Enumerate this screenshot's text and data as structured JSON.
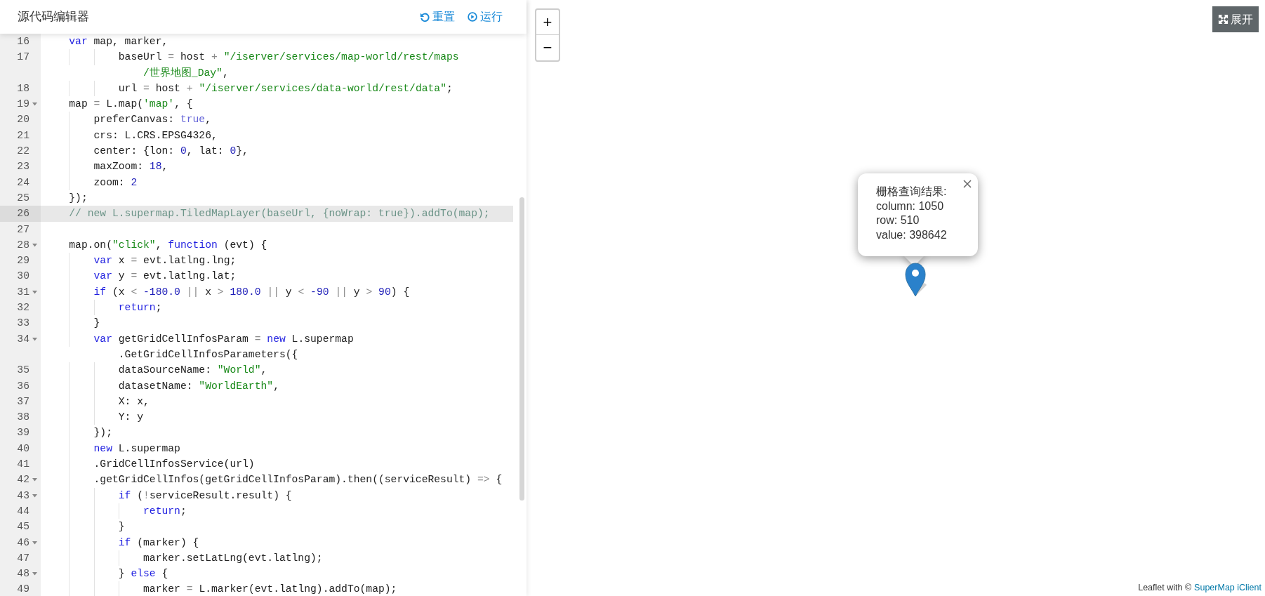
{
  "editor": {
    "title": "源代码编辑器",
    "buttons": [
      {
        "label": "重置"
      },
      {
        "label": "运行"
      }
    ],
    "lines": [
      {
        "number": "16",
        "fold": false,
        "active": false,
        "rows": [
          {
            "tokens": [
              {
                "kind": "k",
                "text": "    var"
              },
              {
                "kind": "t",
                "text": " map, marker,"
              }
            ]
          }
        ]
      },
      {
        "number": "17",
        "fold": false,
        "active": false,
        "rows": [
          {
            "tokens": [
              {
                "kind": "t",
                "text": "            baseUrl "
              },
              {
                "kind": "o",
                "text": "="
              },
              {
                "kind": "t",
                "text": " host "
              },
              {
                "kind": "o",
                "text": "+ "
              },
              {
                "kind": "s",
                "text": "\"/iserver/services/map-world/rest/maps"
              }
            ]
          },
          {
            "tokens": [
              {
                "kind": "s",
                "text": "                /世界地图_Day\""
              },
              {
                "kind": "t",
                "text": ","
              }
            ]
          }
        ]
      },
      {
        "number": "18",
        "fold": false,
        "active": false,
        "rows": [
          {
            "tokens": [
              {
                "kind": "t",
                "text": "            url "
              },
              {
                "kind": "o",
                "text": "="
              },
              {
                "kind": "t",
                "text": " host "
              },
              {
                "kind": "o",
                "text": "+ "
              },
              {
                "kind": "s",
                "text": "\"/iserver/services/data-world/rest/data\""
              },
              {
                "kind": "t",
                "text": ";"
              }
            ]
          }
        ]
      },
      {
        "number": "19",
        "fold": true,
        "active": false,
        "rows": [
          {
            "tokens": [
              {
                "kind": "t",
                "text": "    map "
              },
              {
                "kind": "o",
                "text": "="
              },
              {
                "kind": "t",
                "text": " L.map("
              },
              {
                "kind": "s",
                "text": "'map'"
              },
              {
                "kind": "t",
                "text": ", {"
              }
            ]
          }
        ]
      },
      {
        "number": "20",
        "fold": false,
        "active": false,
        "rows": [
          {
            "tokens": [
              {
                "kind": "t",
                "text": "        preferCanvas: "
              },
              {
                "kind": "a",
                "text": "true"
              },
              {
                "kind": "t",
                "text": ","
              }
            ]
          }
        ]
      },
      {
        "number": "21",
        "fold": false,
        "active": false,
        "rows": [
          {
            "tokens": [
              {
                "kind": "t",
                "text": "        crs: L.CRS.EPSG4326,"
              }
            ]
          }
        ]
      },
      {
        "number": "22",
        "fold": false,
        "active": false,
        "rows": [
          {
            "tokens": [
              {
                "kind": "t",
                "text": "        center: {lon: "
              },
              {
                "kind": "n",
                "text": "0"
              },
              {
                "kind": "t",
                "text": ", lat: "
              },
              {
                "kind": "n",
                "text": "0"
              },
              {
                "kind": "t",
                "text": "},"
              }
            ]
          }
        ]
      },
      {
        "number": "23",
        "fold": false,
        "active": false,
        "rows": [
          {
            "tokens": [
              {
                "kind": "t",
                "text": "        maxZoom: "
              },
              {
                "kind": "n",
                "text": "18"
              },
              {
                "kind": "t",
                "text": ","
              }
            ]
          }
        ]
      },
      {
        "number": "24",
        "fold": false,
        "active": false,
        "rows": [
          {
            "tokens": [
              {
                "kind": "t",
                "text": "        zoom: "
              },
              {
                "kind": "n",
                "text": "2"
              }
            ]
          }
        ]
      },
      {
        "number": "25",
        "fold": false,
        "active": false,
        "rows": [
          {
            "tokens": [
              {
                "kind": "t",
                "text": "    });"
              }
            ]
          }
        ]
      },
      {
        "number": "26",
        "fold": false,
        "active": true,
        "rows": [
          {
            "tokens": [
              {
                "kind": "c",
                "text": "    // new L.supermap.TiledMapLayer(baseUrl, {noWrap: true}).addTo(map);"
              }
            ]
          }
        ]
      },
      {
        "number": "27",
        "fold": false,
        "active": false,
        "rows": [
          {
            "tokens": []
          }
        ]
      },
      {
        "number": "28",
        "fold": true,
        "active": false,
        "rows": [
          {
            "tokens": [
              {
                "kind": "t",
                "text": "    map.on("
              },
              {
                "kind": "s",
                "text": "\"click\""
              },
              {
                "kind": "t",
                "text": ", "
              },
              {
                "kind": "k",
                "text": "function"
              },
              {
                "kind": "t",
                "text": " (evt) {"
              }
            ]
          }
        ]
      },
      {
        "number": "29",
        "fold": false,
        "active": false,
        "rows": [
          {
            "tokens": [
              {
                "kind": "k",
                "text": "        var"
              },
              {
                "kind": "t",
                "text": " x "
              },
              {
                "kind": "o",
                "text": "="
              },
              {
                "kind": "t",
                "text": " evt.latlng.lng;"
              }
            ]
          }
        ]
      },
      {
        "number": "30",
        "fold": false,
        "active": false,
        "rows": [
          {
            "tokens": [
              {
                "kind": "k",
                "text": "        var"
              },
              {
                "kind": "t",
                "text": " y "
              },
              {
                "kind": "o",
                "text": "="
              },
              {
                "kind": "t",
                "text": " evt.latlng.lat;"
              }
            ]
          }
        ]
      },
      {
        "number": "31",
        "fold": true,
        "active": false,
        "rows": [
          {
            "tokens": [
              {
                "kind": "k",
                "text": "        if"
              },
              {
                "kind": "t",
                "text": " (x "
              },
              {
                "kind": "o",
                "text": "< "
              },
              {
                "kind": "n",
                "text": "-180.0 "
              },
              {
                "kind": "o",
                "text": "||"
              },
              {
                "kind": "t",
                "text": " x "
              },
              {
                "kind": "o",
                "text": "> "
              },
              {
                "kind": "n",
                "text": "180.0 "
              },
              {
                "kind": "o",
                "text": "||"
              },
              {
                "kind": "t",
                "text": " y "
              },
              {
                "kind": "o",
                "text": "< "
              },
              {
                "kind": "n",
                "text": "-90 "
              },
              {
                "kind": "o",
                "text": "||"
              },
              {
                "kind": "t",
                "text": " y "
              },
              {
                "kind": "o",
                "text": "> "
              },
              {
                "kind": "n",
                "text": "90"
              },
              {
                "kind": "t",
                "text": ") {"
              }
            ]
          }
        ]
      },
      {
        "number": "32",
        "fold": false,
        "active": false,
        "rows": [
          {
            "tokens": [
              {
                "kind": "k",
                "text": "            return"
              },
              {
                "kind": "t",
                "text": ";"
              }
            ]
          }
        ]
      },
      {
        "number": "33",
        "fold": false,
        "active": false,
        "rows": [
          {
            "tokens": [
              {
                "kind": "t",
                "text": "        }"
              }
            ]
          }
        ]
      },
      {
        "number": "34",
        "fold": true,
        "active": false,
        "rows": [
          {
            "tokens": [
              {
                "kind": "k",
                "text": "        var"
              },
              {
                "kind": "t",
                "text": " getGridCellInfosParam "
              },
              {
                "kind": "o",
                "text": "= "
              },
              {
                "kind": "k",
                "text": "new"
              },
              {
                "kind": "t",
                "text": " L.supermap"
              }
            ]
          },
          {
            "tokens": [
              {
                "kind": "t",
                "text": "            .GetGridCellInfosParameters({"
              }
            ]
          }
        ]
      },
      {
        "number": "35",
        "fold": false,
        "active": false,
        "rows": [
          {
            "tokens": [
              {
                "kind": "t",
                "text": "            dataSourceName: "
              },
              {
                "kind": "s",
                "text": "\"World\""
              },
              {
                "kind": "t",
                "text": ","
              }
            ]
          }
        ]
      },
      {
        "number": "36",
        "fold": false,
        "active": false,
        "rows": [
          {
            "tokens": [
              {
                "kind": "t",
                "text": "            datasetName: "
              },
              {
                "kind": "s",
                "text": "\"WorldEarth\""
              },
              {
                "kind": "t",
                "text": ","
              }
            ]
          }
        ]
      },
      {
        "number": "37",
        "fold": false,
        "active": false,
        "rows": [
          {
            "tokens": [
              {
                "kind": "t",
                "text": "            X: x,"
              }
            ]
          }
        ]
      },
      {
        "number": "38",
        "fold": false,
        "active": false,
        "rows": [
          {
            "tokens": [
              {
                "kind": "t",
                "text": "            Y: y"
              }
            ]
          }
        ]
      },
      {
        "number": "39",
        "fold": false,
        "active": false,
        "rows": [
          {
            "tokens": [
              {
                "kind": "t",
                "text": "        });"
              }
            ]
          }
        ]
      },
      {
        "number": "40",
        "fold": false,
        "active": false,
        "rows": [
          {
            "tokens": [
              {
                "kind": "k",
                "text": "        new"
              },
              {
                "kind": "t",
                "text": " L.supermap"
              }
            ]
          }
        ]
      },
      {
        "number": "41",
        "fold": false,
        "active": false,
        "rows": [
          {
            "tokens": [
              {
                "kind": "t",
                "text": "        .GridCellInfosService(url)"
              }
            ]
          }
        ]
      },
      {
        "number": "42",
        "fold": true,
        "active": false,
        "rows": [
          {
            "tokens": [
              {
                "kind": "t",
                "text": "        .getGridCellInfos(getGridCellInfosParam).then((serviceResult) "
              },
              {
                "kind": "o",
                "text": "=>"
              },
              {
                "kind": "t",
                "text": " {"
              }
            ]
          }
        ]
      },
      {
        "number": "43",
        "fold": true,
        "active": false,
        "rows": [
          {
            "tokens": [
              {
                "kind": "k",
                "text": "            if"
              },
              {
                "kind": "t",
                "text": " ("
              },
              {
                "kind": "o",
                "text": "!"
              },
              {
                "kind": "t",
                "text": "serviceResult.result) {"
              }
            ]
          }
        ]
      },
      {
        "number": "44",
        "fold": false,
        "active": false,
        "rows": [
          {
            "tokens": [
              {
                "kind": "k",
                "text": "                return"
              },
              {
                "kind": "t",
                "text": ";"
              }
            ]
          }
        ]
      },
      {
        "number": "45",
        "fold": false,
        "active": false,
        "rows": [
          {
            "tokens": [
              {
                "kind": "t",
                "text": "            }"
              }
            ]
          }
        ]
      },
      {
        "number": "46",
        "fold": true,
        "active": false,
        "rows": [
          {
            "tokens": [
              {
                "kind": "k",
                "text": "            if"
              },
              {
                "kind": "t",
                "text": " (marker) {"
              }
            ]
          }
        ]
      },
      {
        "number": "47",
        "fold": false,
        "active": false,
        "rows": [
          {
            "tokens": [
              {
                "kind": "t",
                "text": "                marker.setLatLng(evt.latlng);"
              }
            ]
          }
        ]
      },
      {
        "number": "48",
        "fold": true,
        "active": false,
        "rows": [
          {
            "tokens": [
              {
                "kind": "t",
                "text": "            } "
              },
              {
                "kind": "k",
                "text": "else"
              },
              {
                "kind": "t",
                "text": " {"
              }
            ]
          }
        ]
      },
      {
        "number": "49",
        "fold": false,
        "active": false,
        "rows": [
          {
            "tokens": [
              {
                "kind": "t",
                "text": "                marker "
              },
              {
                "kind": "o",
                "text": "="
              },
              {
                "kind": "t",
                "text": " L.marker(evt.latlng).addTo(map);"
              }
            ]
          }
        ]
      }
    ]
  },
  "map": {
    "zoom_in": "+",
    "zoom_out": "−",
    "expand_button": "展开",
    "popup": {
      "title": "栅格查询结果:",
      "lines": [
        "column: 1050",
        "row: 510",
        "value: 398642"
      ]
    },
    "attribution": {
      "text": "Leaflet with ©",
      "link": "SuperMap iClient"
    }
  }
}
